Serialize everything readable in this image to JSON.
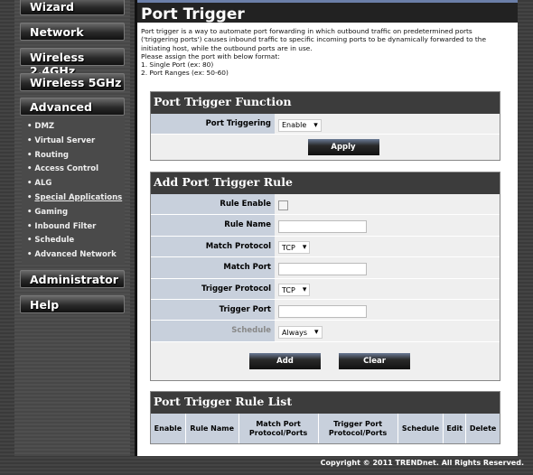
{
  "sidebar": {
    "menus": [
      "Wizard",
      "Network",
      "Wireless 2.4GHz",
      "Wireless 5GHz",
      "Advanced",
      "Administrator",
      "Help"
    ],
    "advanced_items": [
      "DMZ",
      "Virtual Server",
      "Routing",
      "Access Control",
      "ALG",
      "Special Applications",
      "Gaming",
      "Inbound Filter",
      "Schedule",
      "Advanced Network"
    ],
    "active_item": "Special Applications"
  },
  "page": {
    "title": "Port Trigger",
    "description": [
      "Port trigger is a way to automate port forwarding in which outbound traffic on predetermined ports",
      "('triggering ports') causes inbound traffic to specific incoming ports to be dynamically forwarded to the",
      "initiating host, while the outbound ports are in use.",
      "Please assign the port with below format:",
      "1. Single Port (ex: 80)",
      "2. Port Ranges (ex: 50-60)"
    ]
  },
  "function": {
    "title": "Port Trigger Function",
    "label": "Port Triggering",
    "value": "Enable",
    "apply": "Apply"
  },
  "rule": {
    "title": "Add Port Trigger Rule",
    "rule_enable": "Rule Enable",
    "rule_enable_checked": false,
    "rule_name": "Rule Name",
    "rule_name_value": "",
    "match_protocol": "Match Protocol",
    "match_protocol_value": "TCP",
    "match_port": "Match Port",
    "match_port_value": "",
    "trigger_protocol": "Trigger Protocol",
    "trigger_protocol_value": "TCP",
    "trigger_port": "Trigger Port",
    "trigger_port_value": "",
    "schedule": "Schedule",
    "schedule_value": "Always",
    "add": "Add",
    "clear": "Clear"
  },
  "list": {
    "title": "Port Trigger Rule List",
    "columns": [
      "Enable",
      "Rule Name",
      "Match Port Protocol/Ports",
      "Trigger Port Protocol/Ports",
      "Schedule",
      "Edit",
      "Delete"
    ]
  },
  "footer": {
    "copyright": "Copyright © 2011 TRENDnet. All Rights Reserved."
  }
}
